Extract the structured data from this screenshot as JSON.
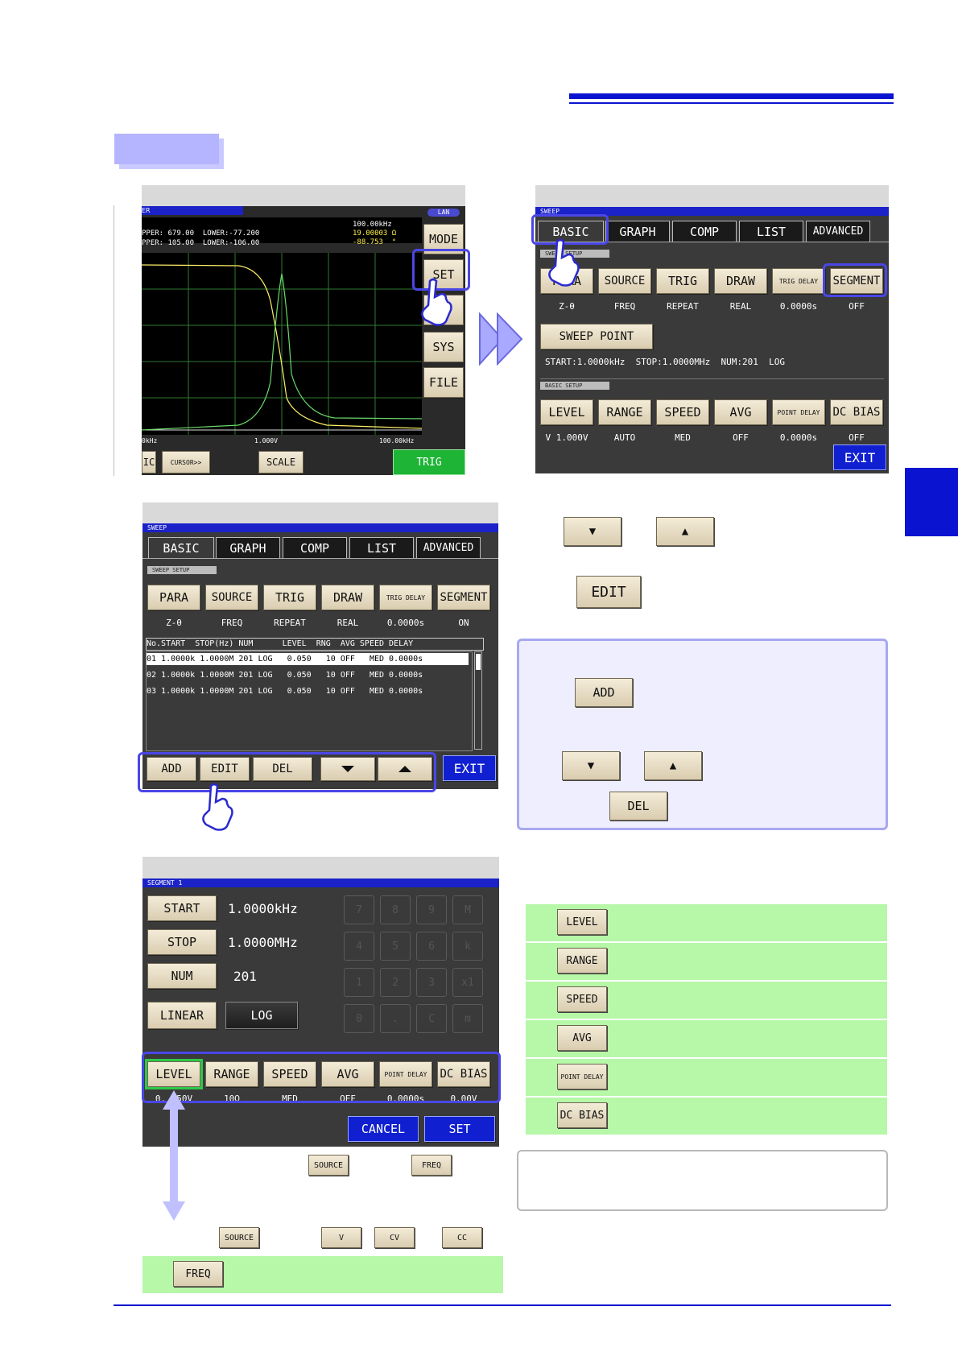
{
  "colors": {
    "accent_blue": "#1a22c8",
    "highlight": "#4a46e6",
    "info_bg": "#eeeeff",
    "green_row": "#b6f7a8",
    "tab_marker": "#0a14d0"
  },
  "screen1": {
    "badge": "LAN",
    "partial_label": "ER",
    "upper1": "PPER: 679.00  LOWER:-77.200",
    "upper2": "PPER: 105.00  LOWER:-106.00",
    "readout_freq": "100.00kHz",
    "readout_z": "19.00003 Ω",
    "readout_phase": "-88.753  °",
    "side_buttons": [
      "MODE",
      "SET",
      "J",
      "SYS",
      "FILE"
    ],
    "axis_left": "0kHz",
    "axis_mid": "1.000V",
    "axis_right": "100.00kHz",
    "bottom_buttons": [
      "IC",
      "CURSOR>>",
      "SCALE",
      "TRIG"
    ]
  },
  "screen2": {
    "title": "SWEEP",
    "tabs": [
      "BASIC",
      "GRAPH",
      "COMP",
      "LIST",
      "ADVANCED"
    ],
    "section1": "SWEEP SETUP",
    "row1_buttons": [
      "PARA",
      "SOURCE",
      "TRIG",
      "DRAW",
      "TRIG DELAY",
      "SEGMENT"
    ],
    "row1_values": [
      "Z-θ",
      "FREQ",
      "REPEAT",
      "REAL",
      "0.0000s",
      "OFF"
    ],
    "sweep_point": "SWEEP POINT",
    "sweep_info": "START:1.0000kHz  STOP:1.0000MHz  NUM:201  LOG",
    "section2": "BASIC SETUP",
    "row2_buttons": [
      "LEVEL",
      "RANGE",
      "SPEED",
      "AVG",
      "POINT DELAY",
      "DC BIAS"
    ],
    "row2_values": [
      "V 1.000V",
      "AUTO",
      "MED",
      "OFF",
      "0.0000s",
      "OFF"
    ],
    "exit": "EXIT"
  },
  "screen3": {
    "title": "SWEEP",
    "tabs": [
      "BASIC",
      "GRAPH",
      "COMP",
      "LIST",
      "ADVANCED"
    ],
    "section1": "SWEEP SETUP",
    "row1_buttons": [
      "PARA",
      "SOURCE",
      "TRIG",
      "DRAW",
      "TRIG DELAY",
      "SEGMENT"
    ],
    "row1_values": [
      "Z-θ",
      "FREQ",
      "REPEAT",
      "REAL",
      "0.0000s",
      "ON"
    ],
    "table_header": "No.START  STOP(Hz) NUM      LEVEL  RNG  AVG SPEED DELAY",
    "rows": [
      "01 1.0000k 1.0000M 201 LOG   0.050   10 OFF   MED 0.0000s",
      "02 1.0000k 1.0000M 201 LOG   0.050   10 OFF   MED 0.0000s",
      "03 1.0000k 1.0000M 201 LOG   0.050   10 OFF   MED 0.0000s"
    ],
    "bottom_buttons": [
      "ADD",
      "EDIT",
      "DEL"
    ],
    "exit": "EXIT"
  },
  "screen4": {
    "title": "SEGMENT 1",
    "start_label": "START",
    "start_value": "1.0000kHz",
    "stop_label": "STOP",
    "stop_value": "1.0000MHz",
    "num_label": "NUM",
    "num_value": "201",
    "linear": "LINEAR",
    "log": "LOG",
    "keypad": [
      "7",
      "8",
      "9",
      "M",
      "4",
      "5",
      "6",
      "k",
      "1",
      "2",
      "3",
      "x1",
      "0",
      ".",
      "C",
      "m"
    ],
    "row_buttons": [
      "LEVEL",
      "RANGE",
      "SPEED",
      "AVG",
      "POINT DELAY",
      "DC BIAS"
    ],
    "row_values": [
      "0.  50V",
      "10Ω",
      "MED",
      "OFF",
      "0.0000s",
      "0.00V"
    ],
    "cancel": "CANCEL",
    "set": "SET"
  },
  "instructions": {
    "down_key": "▼",
    "up_key": "▲",
    "edit": "EDIT",
    "info_add": "ADD",
    "info_del": "DEL"
  },
  "params": [
    "LEVEL",
    "RANGE",
    "SPEED",
    "AVG",
    "POINT DELAY",
    "DC BIAS"
  ],
  "note": {
    "source": "SOURCE",
    "freq": "FREQ",
    "source2": "SOURCE",
    "v": "V",
    "cv": "CV",
    "cc": "CC",
    "freq2": "FREQ"
  }
}
